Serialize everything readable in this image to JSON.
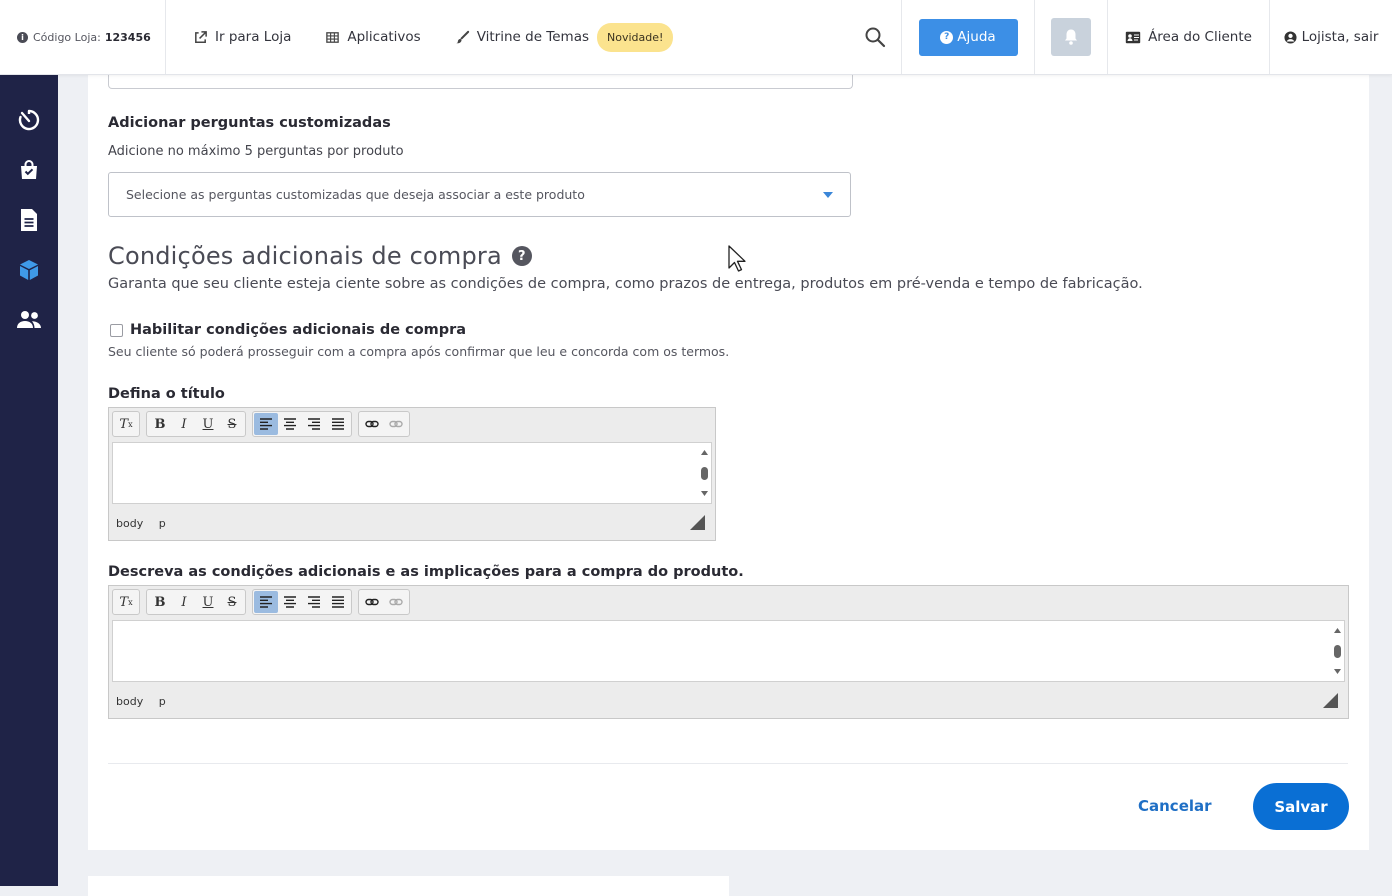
{
  "topbar": {
    "store_code_label": "Código Loja:",
    "store_code_value": "123456",
    "nav": [
      {
        "label": "Ir para Loja",
        "icon": "external-link-icon"
      },
      {
        "label": "Aplicativos",
        "icon": "grid-icon"
      },
      {
        "label": "Vitrine de Temas",
        "icon": "brush-icon"
      }
    ],
    "new_badge": "Novidade!",
    "help_label": "Ajuda",
    "client_area_label": "Área do Cliente",
    "logout_label": "Lojista, sair"
  },
  "sidebar": {
    "items": [
      {
        "icon": "dashboard-timer-icon"
      },
      {
        "icon": "shopping-bag-icon"
      },
      {
        "icon": "document-icon"
      },
      {
        "icon": "product-box-icon",
        "active": true
      },
      {
        "icon": "customers-icon"
      }
    ]
  },
  "custom_questions": {
    "title": "Adicionar perguntas customizadas",
    "subtitle": "Adicione no máximo 5 perguntas por produto",
    "select_placeholder": "Selecione as perguntas customizadas que deseja associar a este produto"
  },
  "conditions": {
    "title": "Condições adicionais de compra",
    "description": "Garanta que seu cliente esteja ciente sobre as condições de compra, como prazos de entrega, produtos em pré-venda e tempo de fabricação.",
    "enable_label": "Habilitar condições adicionais de compra",
    "enable_checked": false,
    "enable_note": "Seu cliente só poderá prosseguir com a compra após confirmar que leu e concorda com os termos.",
    "title_field_label": "Defina o título",
    "description_field_label": "Descreva as condições adicionais e as implicações para a compra do produto."
  },
  "editor": {
    "toolbar_groups": [
      [
        "clear-format"
      ],
      [
        "bold",
        "italic",
        "underline",
        "strikethrough"
      ],
      [
        "align-left",
        "align-center",
        "align-right",
        "justify"
      ],
      [
        "link",
        "unlink"
      ]
    ],
    "path": [
      "body",
      "p"
    ]
  },
  "actions": {
    "cancel_label": "Cancelar",
    "save_label": "Salvar"
  },
  "colors": {
    "sidebar_bg": "#1f2347",
    "primary": "#0a6fd4",
    "help_button": "#3c8fe6",
    "badge_bg": "#fbe38e"
  }
}
